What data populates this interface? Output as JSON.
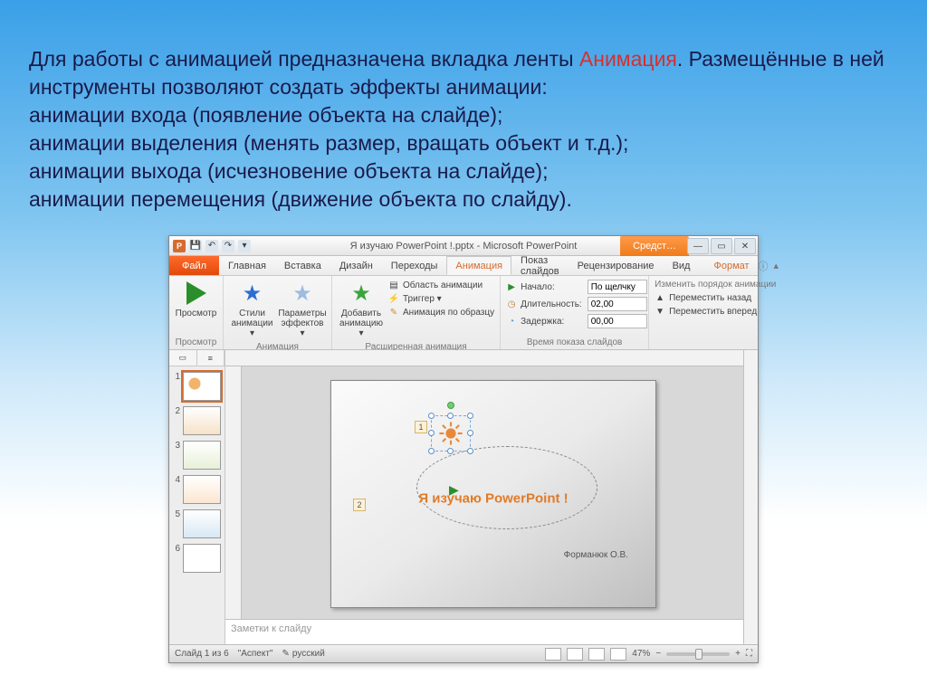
{
  "intro": {
    "p1a": "Для работы с анимацией предназначена вкладка ленты ",
    "p1b": "Анимация",
    "p1c": ". Размещённые в ней инструменты позволяют создать  эффекты анимации:",
    "l1": "анимации входа (появление объекта на слайде);",
    "l2": "анимации выделения (менять размер, вращать объект и т.д.);",
    "l3": "анимации выхода (исчезновение объекта на слайде);",
    "l4": "анимации перемещения (движение объекта по слайду)."
  },
  "title": "Я изучаю PowerPoint !.pptx  -  Microsoft PowerPoint",
  "contextTab": "Средст…",
  "qat": {
    "save": "💾",
    "undo": "↶",
    "redo": "↷",
    "more": "▾"
  },
  "winbtns": {
    "min": "—",
    "max": "▭",
    "close": "✕"
  },
  "tabs": {
    "file": "Файл",
    "home": "Главная",
    "insert": "Вставка",
    "design": "Дизайн",
    "transitions": "Переходы",
    "animations": "Анимация",
    "slideshow": "Показ слайдов",
    "review": "Рецензирование",
    "view": "Вид",
    "format": "Формат"
  },
  "ribActions": {
    "help": "ⓘ",
    "min": "▴"
  },
  "ribbon": {
    "grp_preview": "Просмотр",
    "preview": "Просмотр",
    "grp_animation": "Анимация",
    "styles": "Стили анимации ▾",
    "effects": "Параметры эффектов ▾",
    "grp_advanced": "Расширенная анимация",
    "add": "Добавить анимацию ▾",
    "pane": "Область анимации",
    "trigger": "Триггер ▾",
    "painter": "Анимация по образцу",
    "grp_timing": "Время показа слайдов",
    "start_lbl": "Начало:",
    "start_val": "По щелчку",
    "dur_lbl": "Длительность:",
    "dur_val": "02,00",
    "delay_lbl": "Задержка:",
    "delay_val": "00,00",
    "reorder": "Изменить порядок анимации",
    "move_back": "Переместить назад",
    "move_fwd": "Переместить вперед"
  },
  "thumbs": {
    "tab1": "▭",
    "tab2": "≡",
    "items": [
      {
        "n": "1"
      },
      {
        "n": "2"
      },
      {
        "n": "3"
      },
      {
        "n": "4"
      },
      {
        "n": "5"
      },
      {
        "n": "6"
      }
    ]
  },
  "slide": {
    "title": "Я изучаю PowerPoint !",
    "subtitle": "Форманюк О.В.",
    "tag1": "1",
    "tag2": "2"
  },
  "notes": "Заметки к слайду",
  "status": {
    "slide": "Слайд 1 из 6",
    "theme": "\"Аспект\"",
    "lang": "русский",
    "zoom": "47%"
  }
}
